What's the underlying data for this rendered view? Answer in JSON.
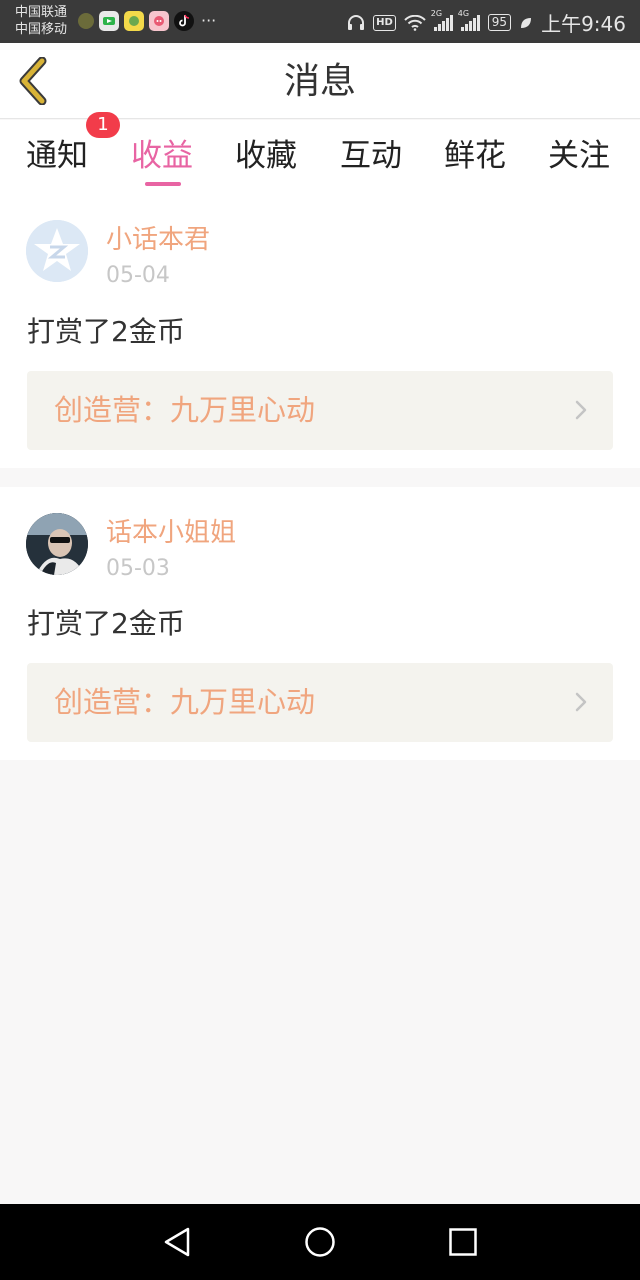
{
  "status_bar": {
    "carrier1": "中国联通",
    "carrier2": "中国移动",
    "hd": "HD",
    "net1": "2G",
    "net2": "4G",
    "battery": "95",
    "time": "上午9:46",
    "dots": "···"
  },
  "header": {
    "title": "消息"
  },
  "tabs": [
    {
      "label": "通知"
    },
    {
      "label": "收益",
      "active": true
    },
    {
      "label": "收藏"
    },
    {
      "label": "互动"
    },
    {
      "label": "鲜花"
    },
    {
      "label": "关注"
    }
  ],
  "notice_badge": "1",
  "messages": [
    {
      "name": "小话本君",
      "date": "05-04",
      "text": "打赏了2金币",
      "link": "创造营：九万里心动"
    },
    {
      "name": "话本小姐姐",
      "date": "05-03",
      "text": "打赏了2金币",
      "link": "创造营：九万里心动"
    }
  ],
  "colors": {
    "accent_pink": "#e864a3",
    "name_orange": "#f0a57e",
    "badge_red": "#f23c4a",
    "back_gold": "#d8b337"
  }
}
